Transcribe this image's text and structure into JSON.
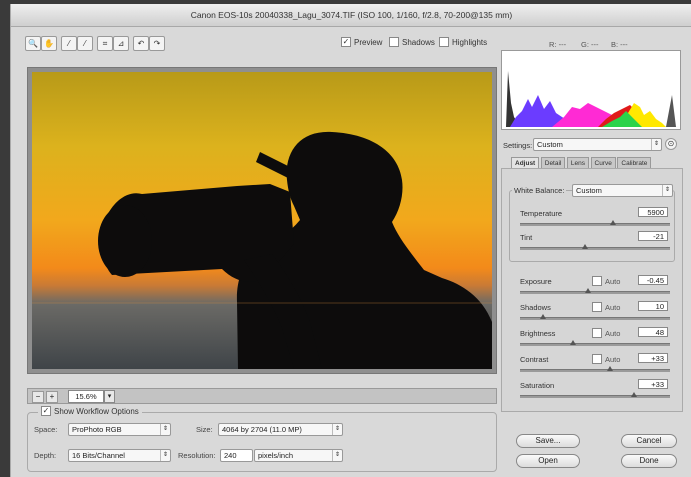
{
  "window": {
    "title": "Canon EOS-10s 20040338_Lagu_3074.TIF (ISO 100, 1/160, f/2.8, 70-200@135 mm)"
  },
  "toolbar": {
    "tools": [
      {
        "name": "zoom-tool-icon",
        "glyph": "🔍"
      },
      {
        "name": "hand-tool-icon",
        "glyph": "✋"
      },
      {
        "name": "white-balance-tool-icon",
        "glyph": "⁄"
      },
      {
        "name": "color-sampler-tool-icon",
        "glyph": "⁄"
      },
      {
        "name": "crop-tool-icon",
        "glyph": "⌗"
      },
      {
        "name": "straighten-tool-icon",
        "glyph": "⊿"
      },
      {
        "name": "rotate-left-icon",
        "glyph": "↶"
      },
      {
        "name": "rotate-right-icon",
        "glyph": "↷"
      }
    ],
    "preview_label": "Preview",
    "shadows_label": "Shadows",
    "highlights_label": "Highlights",
    "readout": {
      "r": "R: ---",
      "g": "G: ---",
      "b": "B: ---"
    }
  },
  "zoom": {
    "value": "15.6%",
    "minus": "−",
    "plus": "+"
  },
  "workflow": {
    "header": "Show Workflow Options",
    "space_label": "Space:",
    "space_value": "ProPhoto RGB",
    "size_label": "Size:",
    "size_value": "4064 by 2704 (11.0 MP)",
    "depth_label": "Depth:",
    "depth_value": "16 Bits/Channel",
    "resolution_label": "Resolution:",
    "resolution_value": "240",
    "resolution_unit": "pixels/inch"
  },
  "settings": {
    "label": "Settings:",
    "value": "Custom"
  },
  "tabs": [
    "Adjust",
    "Detail",
    "Lens",
    "Curve",
    "Calibrate"
  ],
  "adjust": {
    "white_balance_label": "White Balance:",
    "white_balance_value": "Custom",
    "temperature_label": "Temperature",
    "temperature_value": "5900",
    "temperature_pos": 0.62,
    "tint_label": "Tint",
    "tint_value": "-21",
    "tint_pos": 0.43,
    "auto_label": "Auto",
    "exposure_label": "Exposure",
    "exposure_value": "-0.45",
    "exposure_pos": 0.45,
    "shadows_label": "Shadows",
    "shadows_value": "10",
    "shadows_pos": 0.15,
    "brightness_label": "Brightness",
    "brightness_value": "48",
    "brightness_pos": 0.35,
    "contrast_label": "Contrast",
    "contrast_value": "+33",
    "contrast_pos": 0.6,
    "saturation_label": "Saturation",
    "saturation_value": "+33",
    "saturation_pos": 0.76
  },
  "buttons": {
    "save": "Save...",
    "open": "Open",
    "cancel": "Cancel",
    "done": "Done"
  },
  "colors": {
    "sky_top": "#d7b11c",
    "sky_mid": "#f1a41a",
    "horizon": "#f07a18",
    "sea": "#4a5055",
    "silhouette": "#0d0c0c"
  }
}
